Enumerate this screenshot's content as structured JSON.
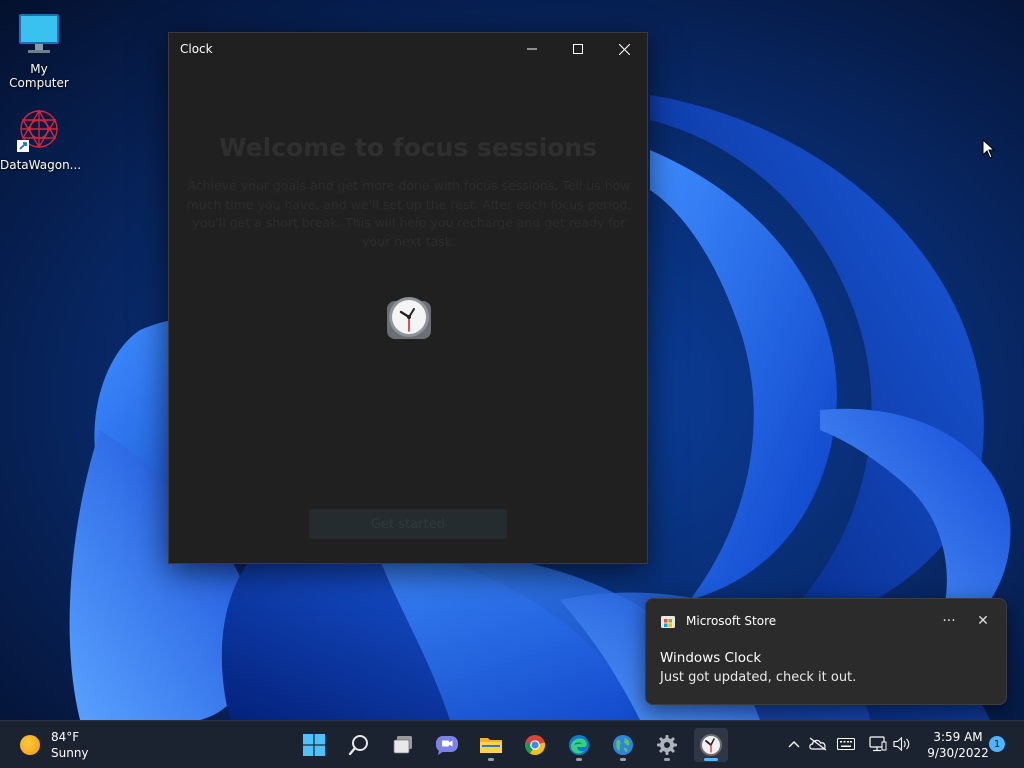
{
  "desktop": {
    "icons": [
      {
        "label": "My Computer",
        "icon": "monitor-icon"
      },
      {
        "label": "DataWagon...",
        "icon": "datawagon-shortcut-icon"
      }
    ]
  },
  "clock_window": {
    "title": "Clock",
    "controls": {
      "minimize": "minimize-icon",
      "maximize": "maximize-icon",
      "close": "close-icon"
    },
    "welcome_title": "Welcome to focus sessions",
    "welcome_body": "Achieve your goals and get more done with focus sessions. Tell us how much time you have, and we'll set up the rest. After each focus period, you'll get a short break. This will help you recharge and get ready for your next task.",
    "button_label": "Get started"
  },
  "toast": {
    "app_name": "Microsoft Store",
    "more_label": "···",
    "close_label": "✕",
    "title": "Windows Clock",
    "body": "Just got updated, check it out."
  },
  "taskbar": {
    "weather": {
      "temp": "84°F",
      "condition": "Sunny"
    },
    "apps": [
      {
        "name": "start",
        "icon": "windows-start-icon"
      },
      {
        "name": "search",
        "icon": "search-icon"
      },
      {
        "name": "task-view",
        "icon": "task-view-icon"
      },
      {
        "name": "teams-chat",
        "icon": "teams-chat-icon"
      },
      {
        "name": "file-explorer",
        "icon": "folder-icon"
      },
      {
        "name": "chrome",
        "icon": "chrome-icon"
      },
      {
        "name": "edge",
        "icon": "edge-icon"
      },
      {
        "name": "maps-app",
        "icon": "globe-app-icon"
      },
      {
        "name": "settings",
        "icon": "gear-icon"
      },
      {
        "name": "clock",
        "icon": "clock-icon"
      }
    ],
    "tray": {
      "time": "3:59 AM",
      "date": "9/30/2022",
      "notification_count": "1"
    }
  },
  "colors": {
    "accent": "#4cc2ff",
    "window_bg": "#202020",
    "taskbar_bg": "#1c2330",
    "toast_bg": "#2b2b2b"
  }
}
